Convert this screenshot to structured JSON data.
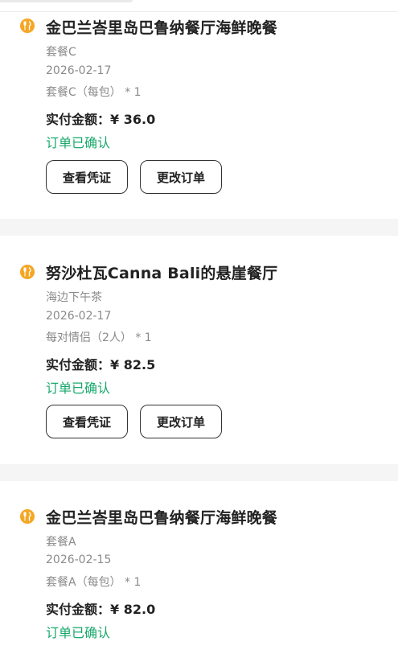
{
  "orders": [
    {
      "restaurant": "金巴兰峇里岛巴鲁纳餐厅海鲜晚餐",
      "package": "套餐C",
      "date": "2026-02-17",
      "spec": "套餐C（每包） * 1",
      "paid_label": "实付金额：",
      "paid_amount": "¥ 36.0",
      "status": "订单已确认",
      "voucher_button": "查看凭证",
      "modify_button": "更改订单"
    },
    {
      "restaurant": "努沙杜瓦Canna Bali的悬崖餐厅",
      "package": "海边下午茶",
      "date": "2026-02-17",
      "spec": "每对情侣（2人） * 1",
      "paid_label": "实付金额：",
      "paid_amount": "¥ 82.5",
      "status": "订单已确认",
      "voucher_button": "查看凭证",
      "modify_button": "更改订单"
    },
    {
      "restaurant": "金巴兰峇里岛巴鲁纳餐厅海鲜晚餐",
      "package": "套餐A",
      "date": "2026-02-15",
      "spec": "套餐A（每包） * 1",
      "paid_label": "实付金额：",
      "paid_amount": "¥ 82.0",
      "status": "订单已确认"
    }
  ],
  "icon": "restaurant-icon",
  "colors": {
    "icon_bg": "#f5a623",
    "status": "#17a86b",
    "page_bg": "#f5f5f5"
  }
}
